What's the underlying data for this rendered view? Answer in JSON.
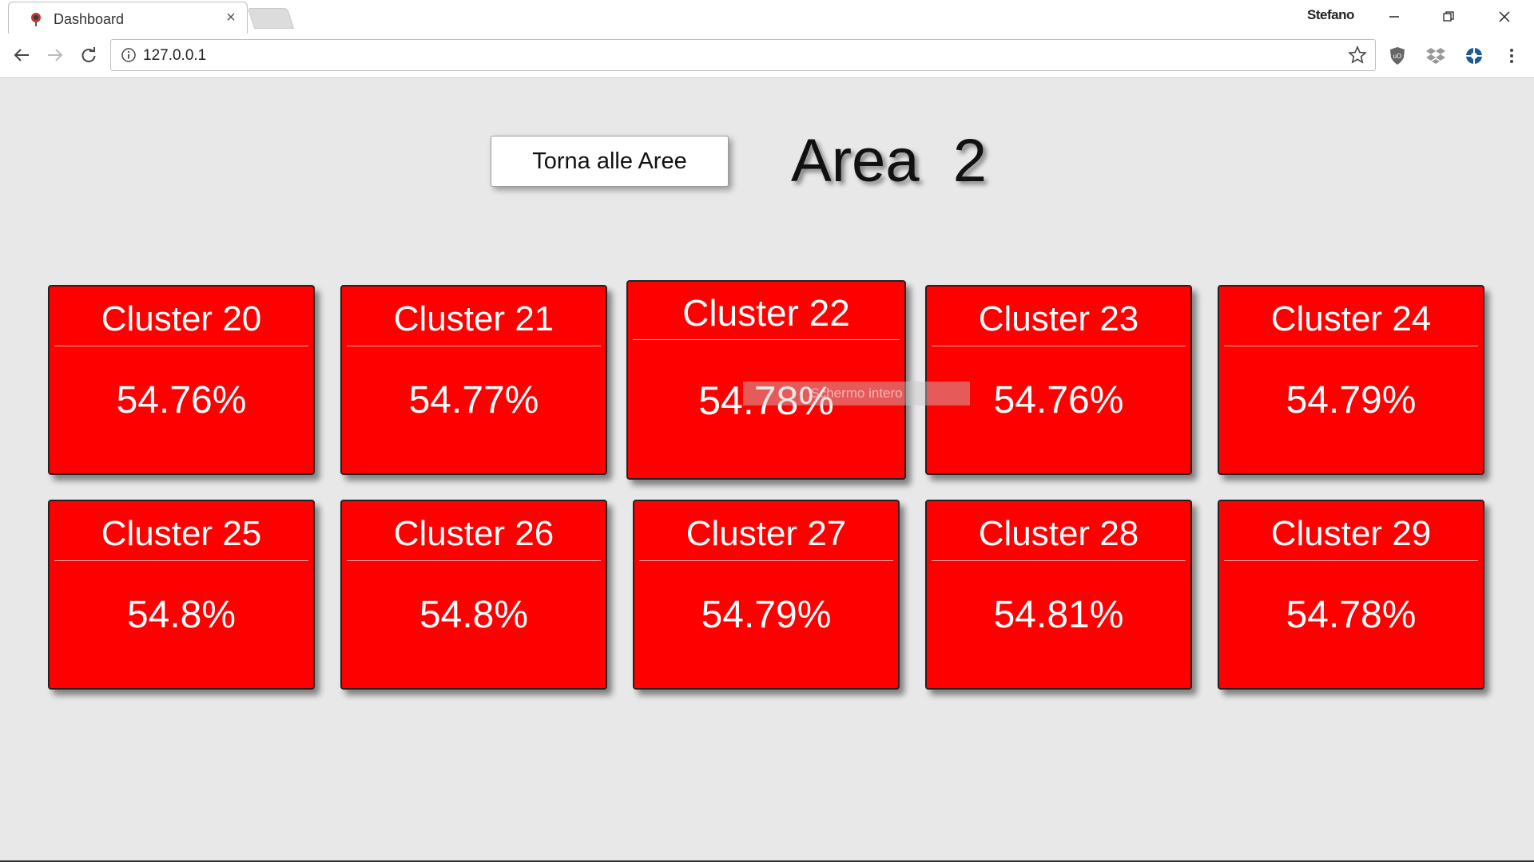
{
  "browser": {
    "tab_title": "Dashboard",
    "profile_name": "Stefano",
    "url": "127.0.0.1"
  },
  "page": {
    "back_button_label": "Torna alle Aree",
    "area_title": "Area  2",
    "fullscreen_hint": "Schermo intero",
    "clusters": [
      {
        "name": "Cluster 20",
        "value": "54.76%"
      },
      {
        "name": "Cluster 21",
        "value": "54.77%"
      },
      {
        "name": "Cluster 22",
        "value": "54.78%"
      },
      {
        "name": "Cluster 23",
        "value": "54.76%"
      },
      {
        "name": "Cluster 24",
        "value": "54.79%"
      },
      {
        "name": "Cluster 25",
        "value": "54.8%"
      },
      {
        "name": "Cluster 26",
        "value": "54.8%"
      },
      {
        "name": "Cluster 27",
        "value": "54.79%"
      },
      {
        "name": "Cluster 28",
        "value": "54.81%"
      },
      {
        "name": "Cluster 29",
        "value": "54.78%"
      }
    ],
    "card_color": "#ff0000",
    "background_color": "#e8e8e8"
  }
}
